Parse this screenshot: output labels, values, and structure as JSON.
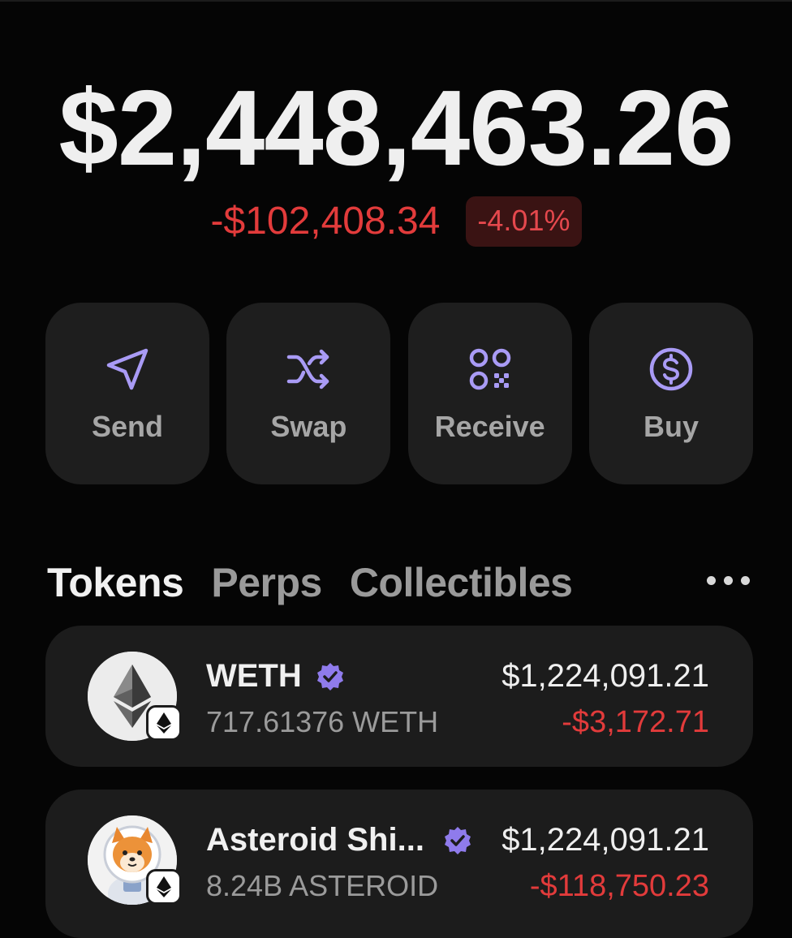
{
  "portfolio": {
    "balance": "$2,448,463.26",
    "change_amount": "-$102,408.34",
    "change_percent": "-4.01%"
  },
  "actions": [
    {
      "label": "Send",
      "icon": "send-icon"
    },
    {
      "label": "Swap",
      "icon": "shuffle-icon"
    },
    {
      "label": "Receive",
      "icon": "qr-code-icon"
    },
    {
      "label": "Buy",
      "icon": "dollar-circle-icon"
    }
  ],
  "tabs": [
    {
      "label": "Tokens",
      "active": true
    },
    {
      "label": "Perps",
      "active": false
    },
    {
      "label": "Collectibles",
      "active": false
    }
  ],
  "more_icon": "more-horizontal-icon",
  "tokens": [
    {
      "name": "WETH",
      "quantity": "717.61376 WETH",
      "value": "$1,224,091.21",
      "change": "-$3,172.71",
      "icon": "ethereum-icon",
      "chain_icon": "ethereum-chain-icon",
      "verified": true
    },
    {
      "name": "Asteroid Shi...",
      "quantity": "8.24B ASTEROID",
      "value": "$1,224,091.21",
      "change": "-$118,750.23",
      "icon": "shiba-astronaut-icon",
      "chain_icon": "ethereum-chain-icon",
      "verified": true
    }
  ],
  "colors": {
    "background": "#050505",
    "card": "#1e1e1e",
    "accent_purple": "#a99bf5",
    "negative_red": "#e23b3b",
    "badge_red_bg": "#3a1313"
  }
}
